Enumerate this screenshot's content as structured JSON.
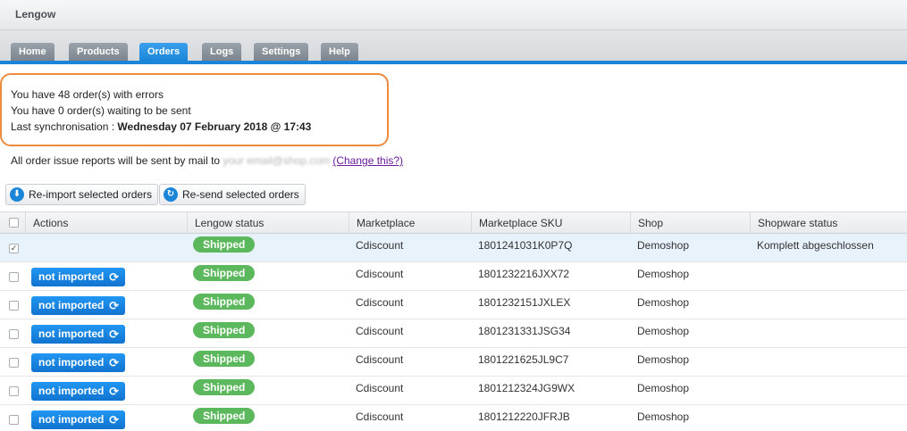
{
  "app": {
    "title": "Lengow"
  },
  "tabs": [
    {
      "label": "Home",
      "active": false
    },
    {
      "label": "Products",
      "active": false
    },
    {
      "label": "Orders",
      "active": true
    },
    {
      "label": "Logs",
      "active": false
    },
    {
      "label": "Settings",
      "active": false
    },
    {
      "label": "Help",
      "active": false
    }
  ],
  "summary": {
    "errors_line": "You have 48 order(s) with errors",
    "waiting_line": "You have 0 order(s) waiting to be sent",
    "sync_label": "Last synchronisation : ",
    "sync_value": "Wednesday 07 February 2018 @ 17:43"
  },
  "mail_note": {
    "prefix": "All order issue reports will be sent by mail to ",
    "email": "your email@shop.com",
    "change_link": "(Change this?)"
  },
  "buttons": {
    "reimport": "Re-import selected orders",
    "resend": "Re-send selected orders"
  },
  "table": {
    "columns": [
      "Actions",
      "Lengow status",
      "Marketplace",
      "Marketplace SKU",
      "Shop",
      "Shopware status"
    ],
    "rows": [
      {
        "checked": true,
        "action": "",
        "status": "Shipped",
        "marketplace": "Cdiscount",
        "sku": "1801241031K0P7Q",
        "shop": "Demoshop",
        "shopware_status": "Komplett abgeschlossen"
      },
      {
        "checked": false,
        "action": "not imported",
        "status": "Shipped",
        "marketplace": "Cdiscount",
        "sku": "1801232216JXX72",
        "shop": "Demoshop",
        "shopware_status": ""
      },
      {
        "checked": false,
        "action": "not imported",
        "status": "Shipped",
        "marketplace": "Cdiscount",
        "sku": "1801232151JXLEX",
        "shop": "Demoshop",
        "shopware_status": ""
      },
      {
        "checked": false,
        "action": "not imported",
        "status": "Shipped",
        "marketplace": "Cdiscount",
        "sku": "1801231331JSG34",
        "shop": "Demoshop",
        "shopware_status": ""
      },
      {
        "checked": false,
        "action": "not imported",
        "status": "Shipped",
        "marketplace": "Cdiscount",
        "sku": "1801221625JL9C7",
        "shop": "Demoshop",
        "shopware_status": ""
      },
      {
        "checked": false,
        "action": "not imported",
        "status": "Shipped",
        "marketplace": "Cdiscount",
        "sku": "1801212324JG9WX",
        "shop": "Demoshop",
        "shopware_status": ""
      },
      {
        "checked": false,
        "action": "not imported",
        "status": "Shipped",
        "marketplace": "Cdiscount",
        "sku": "1801212220JFRJB",
        "shop": "Demoshop",
        "shopware_status": ""
      }
    ]
  },
  "icons": {
    "reimport": "download-circle-icon",
    "resend": "refresh-circle-icon",
    "sync": "sync-icon"
  },
  "colors": {
    "accent": "#1b86d9",
    "shipped": "#5cb85c",
    "highlight": "#ec8a3e",
    "link": "#6a1b9a"
  }
}
